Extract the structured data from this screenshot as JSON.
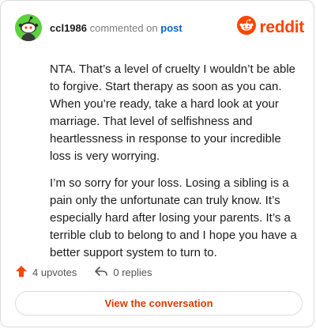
{
  "comment": {
    "username": "ccl1986",
    "action_text": "commented on",
    "post_link": "post",
    "paragraphs": [
      "NTA. That’s a level of cruelty I wouldn’t be able to forgive. Start therapy as soon as you can. When you’re ready, take a hard look at your marriage. That level of selfishness and heartlessness in response to your incredible loss is very worrying.",
      "I’m so sorry for your loss. Losing a sibling is a pain only the unfortunate can truly know. It’s especially hard after losing your parents. It’s a terrible club to belong to and I hope you have a better support system to turn to."
    ]
  },
  "brand": {
    "name": "reddit",
    "icon": "reddit-logo-icon",
    "color": "#ff4500"
  },
  "avatar": {
    "icon": "snoo-avatar-icon",
    "color": "#5bd13b"
  },
  "actions": {
    "upvotes_label": "4 upvotes",
    "upvote_icon": "upvote-arrow-icon",
    "replies_label": "0 replies",
    "reply_icon": "reply-arrow-icon"
  },
  "cta": {
    "label": "View the conversation"
  }
}
